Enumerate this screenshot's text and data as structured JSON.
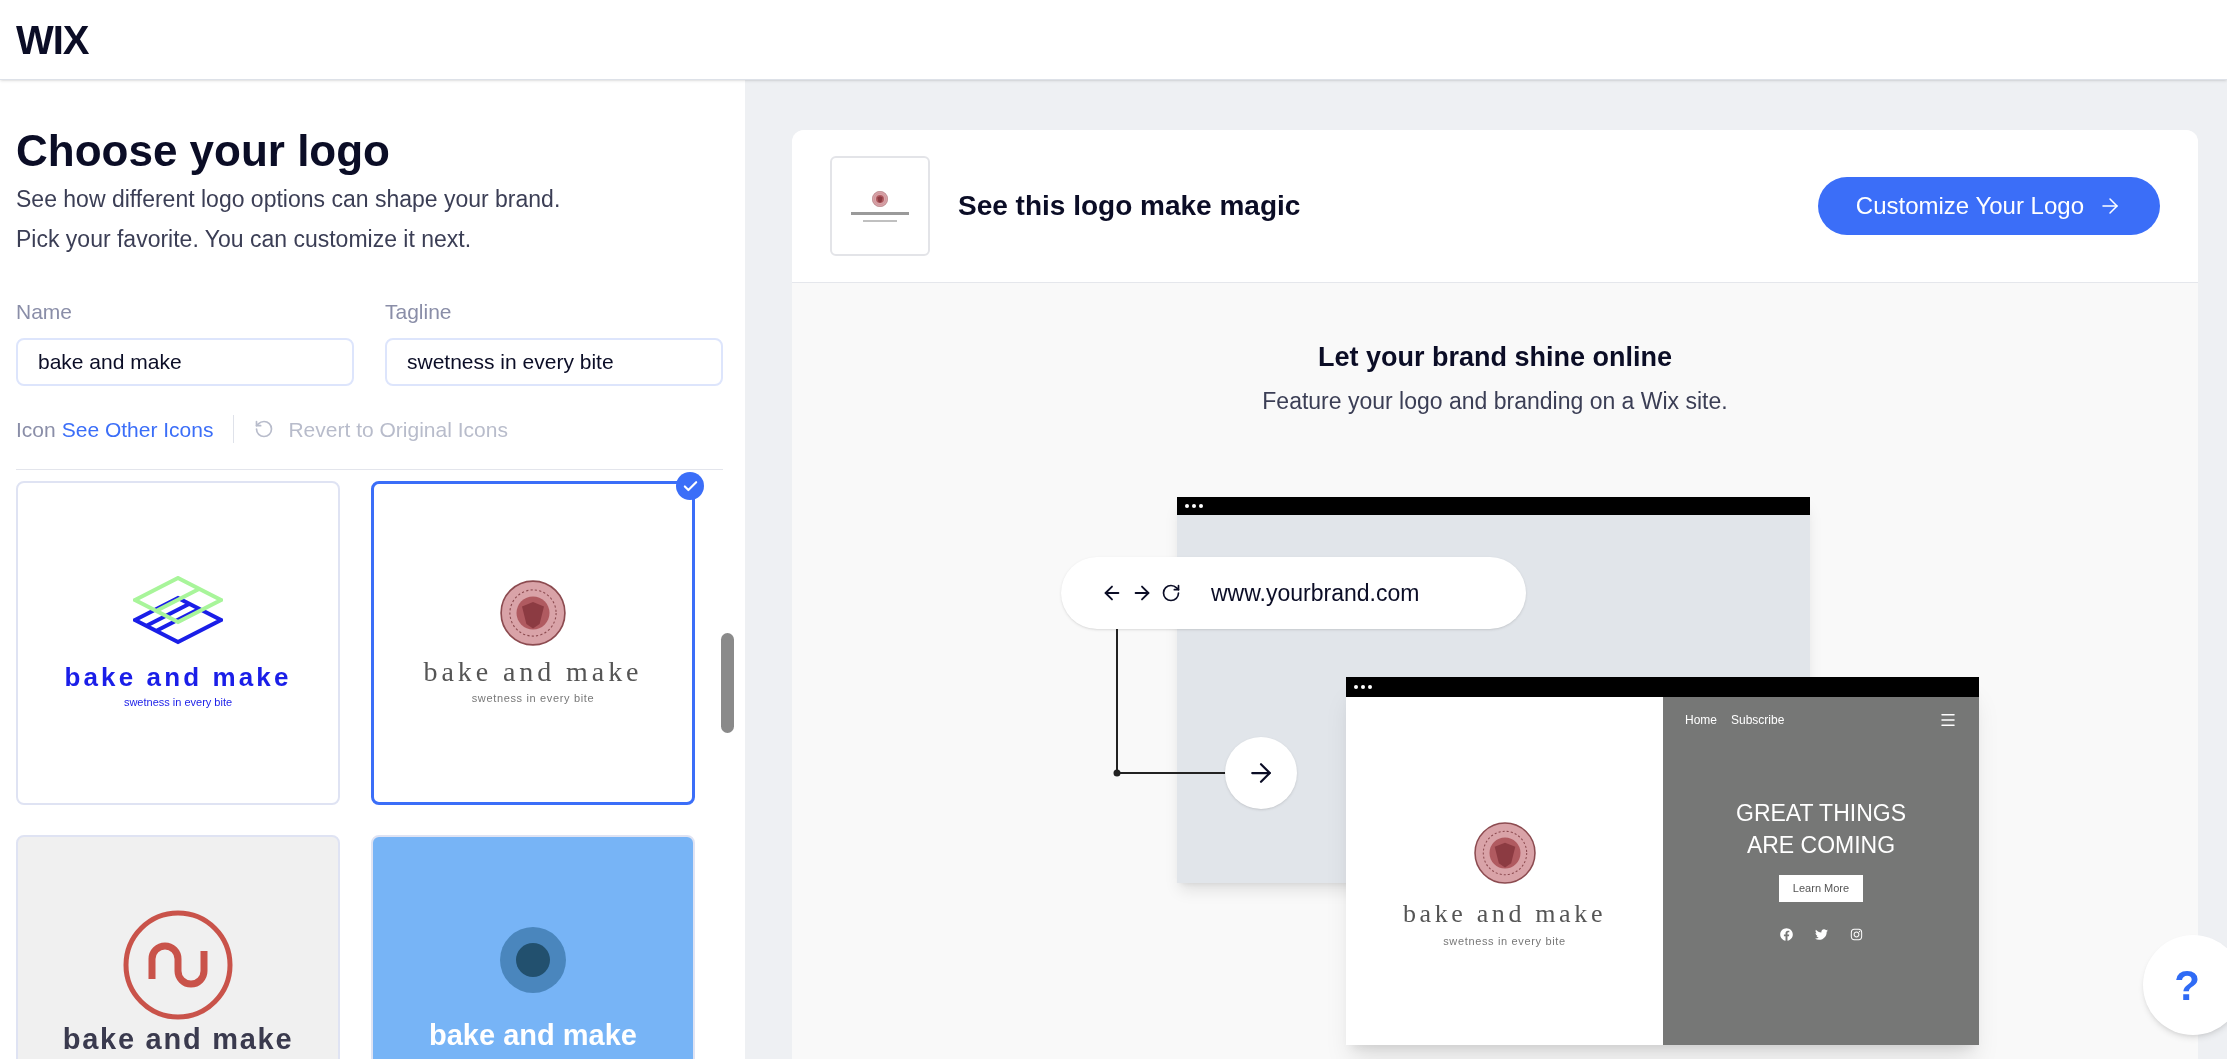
{
  "header": {
    "logo": "WIX"
  },
  "panel": {
    "title": "Choose your logo",
    "description_lines": [
      "See how different logo options can shape your brand.",
      "Pick your favorite. You can customize it next."
    ],
    "fields": [
      {
        "label": "Name",
        "value": "bake and make"
      },
      {
        "label": "Tagline",
        "value": "swetness in every bite"
      }
    ],
    "icon_row": {
      "label": "Icon",
      "link": "See Other Icons",
      "revert": {
        "label": "Revert to Original Icons",
        "disabled": true
      }
    },
    "logo_options": [
      {
        "kind": "layers",
        "name": "bake and make",
        "tagline": "swetness in every bite",
        "selected": false
      },
      {
        "kind": "badge",
        "name": "bake and make",
        "tagline": "swetness in every bite",
        "selected": true
      },
      {
        "kind": "wave",
        "name": "bake and make",
        "selected": false
      },
      {
        "kind": "dot",
        "name": "bake and make",
        "selected": false
      }
    ]
  },
  "preview": {
    "heading": "See this logo make magic",
    "button": "Customize Your Logo"
  },
  "showcase": {
    "title": "Let your brand shine online",
    "subtitle": "Feature your logo and branding on a Wix site.",
    "url": "www.yourbrand.com",
    "site": {
      "nav": [
        "Home",
        "Subscribe"
      ],
      "logo_name": "bake and make",
      "logo_tagline": "swetness in every bite",
      "headline_lines": [
        "GREAT THINGS",
        "ARE COMING"
      ],
      "cta": "Learn More"
    }
  },
  "help": {
    "label": "?"
  }
}
